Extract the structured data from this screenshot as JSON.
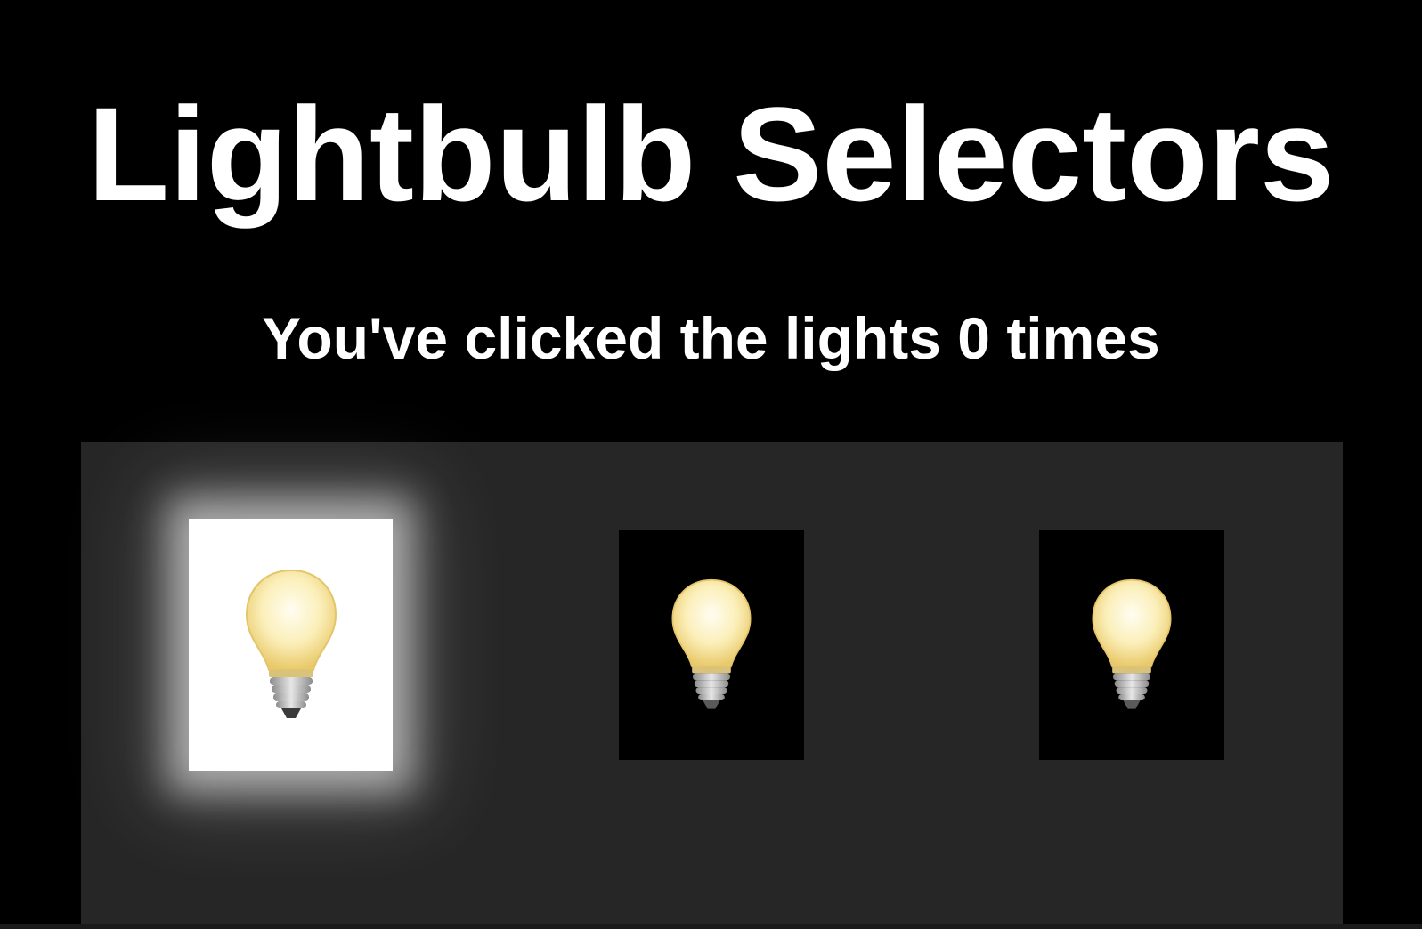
{
  "header": {
    "title": "Lightbulb Selectors"
  },
  "counter": {
    "text": "You've clicked the lights 0 times",
    "clicks": 0
  },
  "bulbs": [
    {
      "state": "on",
      "icon": "lightbulb-icon"
    },
    {
      "state": "off",
      "icon": "lightbulb-icon"
    },
    {
      "state": "off",
      "icon": "lightbulb-icon"
    }
  ],
  "colors": {
    "page_background": "#000000",
    "panel_background": "#262626",
    "card_on": "#ffffff",
    "card_off": "#000000",
    "text": "#ffffff"
  }
}
